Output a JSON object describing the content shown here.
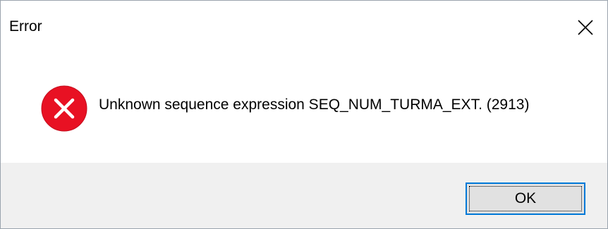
{
  "window": {
    "title": "Error",
    "close_icon": "close-icon"
  },
  "content": {
    "icon": "error-icon",
    "icon_color": "#e81123",
    "message": "Unknown sequence expression SEQ_NUM_TURMA_EXT. (2913)"
  },
  "footer": {
    "ok_label": "OK",
    "accent": "#0078d7"
  }
}
